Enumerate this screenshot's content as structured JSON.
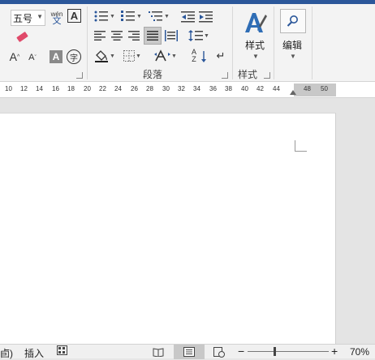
{
  "ribbon": {
    "font_size_value": "五号",
    "phonetic_label": "wén",
    "phonetic_char": "文",
    "char_border_label": "A",
    "grow_font_label": "A",
    "shrink_font_label": "A",
    "char_shading_label": "A",
    "enclosed_char_label": "字",
    "paragraph_group_label": "段落",
    "styles_group_label": "样式",
    "styles_button_label": "样式",
    "edit_button_label": "编辑",
    "sort_label": "A",
    "sort_label2": "Z"
  },
  "ruler": {
    "ticks": [
      "10",
      "12",
      "14",
      "16",
      "18",
      "20",
      "22",
      "24",
      "26",
      "28",
      "30",
      "32",
      "34",
      "36",
      "38",
      "40",
      "42",
      "44",
      "48",
      "50"
    ]
  },
  "status": {
    "left_fragment": "卣)",
    "insert_mode": "插入",
    "zoom_minus": "−",
    "zoom_plus": "+",
    "zoom_level": "70%"
  },
  "colors": {
    "title_bar": "#2b579a",
    "ribbon_bg": "#f3f3f3",
    "selected_button": "#c9c9c9",
    "styles_icon": "#2f6db5",
    "eraser_icon": "#e04a6a"
  }
}
